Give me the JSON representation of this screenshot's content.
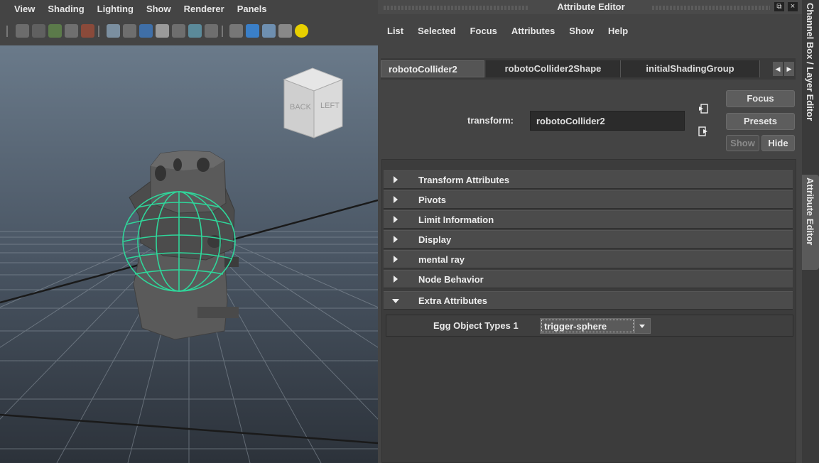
{
  "viewport": {
    "menus": [
      "View",
      "Shading",
      "Lighting",
      "Show",
      "Renderer",
      "Panels"
    ],
    "view_cube": {
      "back_label": "BACK",
      "left_label": "LEFT"
    }
  },
  "attribute_editor": {
    "title": "Attribute Editor",
    "float_button": "⧉",
    "close_button": "×",
    "menus": [
      "List",
      "Selected",
      "Focus",
      "Attributes",
      "Show",
      "Help"
    ],
    "tabs": [
      "robotoCollider2",
      "robotoCollider2Shape",
      "initialShadingGroup"
    ],
    "active_tab": "robotoCollider2",
    "tab_prev": "◀",
    "tab_next": "▶",
    "transform_label": "transform:",
    "transform_value": "robotoCollider2",
    "buttons": {
      "focus": "Focus",
      "presets": "Presets",
      "show": "Show",
      "hide": "Hide"
    },
    "sections": [
      {
        "label": "Transform Attributes",
        "expanded": false
      },
      {
        "label": "Pivots",
        "expanded": false
      },
      {
        "label": "Limit Information",
        "expanded": false
      },
      {
        "label": "Display",
        "expanded": false
      },
      {
        "label": "mental ray",
        "expanded": false
      },
      {
        "label": "Node Behavior",
        "expanded": false
      },
      {
        "label": "Extra Attributes",
        "expanded": true
      }
    ],
    "extra_attributes": {
      "label": "Egg Object Types 1",
      "value": "trigger-sphere"
    }
  },
  "side_tabs": [
    "Channel Box / Layer Editor",
    "Attribute Editor"
  ],
  "colors": {
    "wireframe": "#2fd69a",
    "accent": "#4da6ff"
  }
}
